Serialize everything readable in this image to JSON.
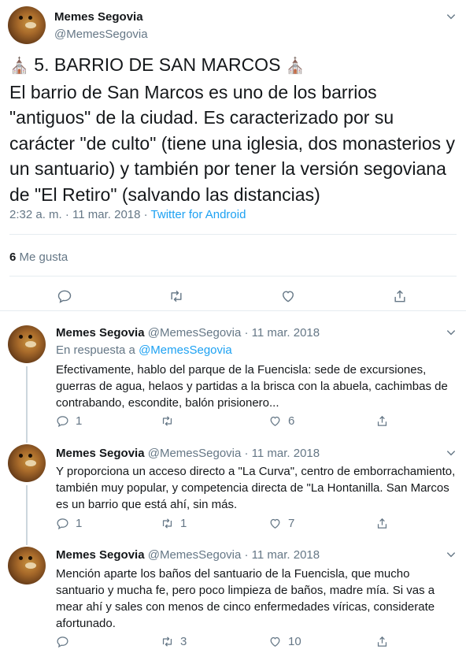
{
  "main": {
    "name": "Memes Segovia",
    "handle": "@MemesSegovia",
    "emoji_left": "⛪",
    "title": "5. BARRIO DE SAN MARCOS",
    "emoji_right": "⛪",
    "body": "El barrio de San Marcos es uno de los barrios \"antiguos\" de la ciudad. Es caracterizado por su carácter \"de culto\" (tiene una iglesia, dos monasterios y un santuario) y también por tener la versión segoviana de \"El Retiro\" (salvando las distancias)",
    "time": "2:32 a. m. · 11 mar. 2018 · ",
    "source": "Twitter for Android",
    "likes_count": "6",
    "likes_label": "Me gusta"
  },
  "replies": [
    {
      "name": "Memes Segovia",
      "meta": "@MemesSegovia · 11 mar. 2018",
      "in_reply_prefix": "En respuesta a ",
      "in_reply_handle": "@MemesSegovia",
      "text": "Efectivamente, hablo del parque de la Fuencisla: sede de excursiones, guerras de agua, helaos y partidas a la brisca con la abuela, cachimbas de contrabando, escondite, balón prisionero...",
      "replies": "1",
      "retweets": "",
      "likes": "6"
    },
    {
      "name": "Memes Segovia",
      "meta": "@MemesSegovia · 11 mar. 2018",
      "text": "Y proporciona un acceso directo a \"La Curva\", centro de emborrachamiento, también muy popular, y competencia directa de \"La Hontanilla. San Marcos es un barrio que está ahí, sin más.",
      "replies": "1",
      "retweets": "1",
      "likes": "7"
    },
    {
      "name": "Memes Segovia",
      "meta": "@MemesSegovia · 11 mar. 2018",
      "text": "Mención aparte los baños del santuario de la Fuencisla, que mucho santuario y mucha fe, pero poco limpieza de baños, madre mía. Si vas a mear ahí y sales con menos de cinco enfermedades víricas, considerate afortunado.",
      "replies": "",
      "retweets": "3",
      "likes": "10"
    }
  ]
}
